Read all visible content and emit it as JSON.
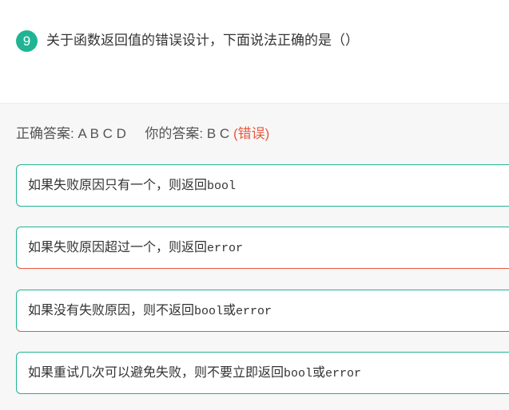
{
  "question": {
    "number": "9",
    "title": "关于函数返回值的错误设计，下面说法正确的是（）"
  },
  "answer": {
    "correct_label": "正确答案:",
    "correct_value": "A B C D",
    "yours_label": "你的答案:",
    "yours_value": "B C",
    "status": "(错误)"
  },
  "options": [
    {
      "text_pre": "如果失败原因只有一个，则返回",
      "code1": "bool",
      "mid": "",
      "code2": ""
    },
    {
      "text_pre": "如果失败原因超过一个，则返回",
      "code1": "error",
      "mid": "",
      "code2": ""
    },
    {
      "text_pre": "如果没有失败原因，则不返回",
      "code1": "bool",
      "mid": "或",
      "code2": "error"
    },
    {
      "text_pre": "如果重试几次可以避免失败，则不要立即返回",
      "code1": "bool",
      "mid": "或",
      "code2": "error"
    }
  ],
  "colors": {
    "accent": "#20b494",
    "error": "#e8573f"
  }
}
